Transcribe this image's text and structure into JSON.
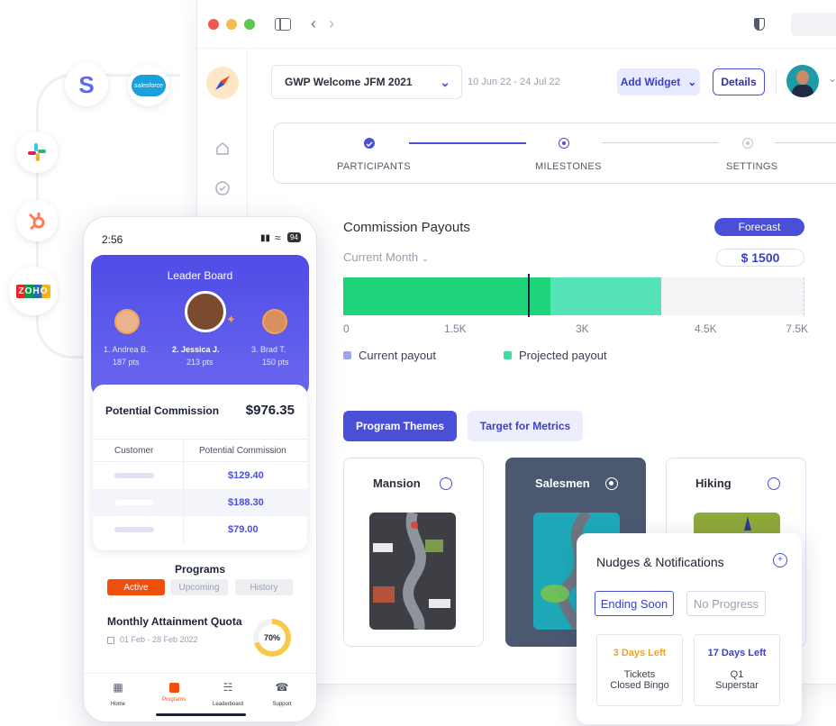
{
  "integrations": [
    "stripe-logo",
    "salesforce-logo",
    "slack-logo",
    "hubspot-logo",
    "zoho-logo"
  ],
  "integration_labels": {
    "salesforce": "salesforce",
    "zoho": "ZOHO",
    "stripe": "S"
  },
  "colors": {
    "accent": "#4a4fd8",
    "current": "#1ed47a",
    "projected": "#55e4b8",
    "active": "#f04e0d",
    "days_orange": "#f0a31e"
  },
  "header": {
    "program_select": "GWP Welcome JFM 2021",
    "date_range": "10 Jun 22 - 24 Jul 22",
    "add_widget": "Add Widget",
    "details": "Details"
  },
  "stepper": {
    "steps": [
      "PARTICIPANTS",
      "MILESTONES",
      "SETTINGS"
    ]
  },
  "payouts": {
    "title": "Commission Payouts",
    "forecast": "Forecast",
    "period": "Current Month",
    "amount": "$ 1500",
    "ticks": [
      "0",
      "1.5K",
      "3K",
      "4.5K",
      "7.5K"
    ],
    "current_fraction": 0.45,
    "projected_fraction": 0.69,
    "marker_fraction": 0.4,
    "legend": {
      "current": "Current payout",
      "projected": "Projected payout"
    }
  },
  "themes_tabs": {
    "program_themes": "Program Themes",
    "target_metrics": "Target for Metrics"
  },
  "themes": [
    {
      "name": "Mansion",
      "selected": false
    },
    {
      "name": "Salesmen",
      "selected": true
    },
    {
      "name": "Hiking",
      "selected": false
    }
  ],
  "phone": {
    "time": "2:56",
    "battery": "94",
    "leaderboard_title": "Leader Board",
    "leaders": [
      {
        "rank_name": "1. Andrea B.",
        "pts": "187 pts"
      },
      {
        "rank_name": "2. Jessica J.",
        "pts": "213 pts"
      },
      {
        "rank_name": "3. Brad T.",
        "pts": "150 pts"
      }
    ],
    "potential_label": "Potential Commission",
    "potential_value": "$976.35",
    "table_headers": [
      "Customer",
      "Potential Commission"
    ],
    "rows": [
      "$129.40",
      "$188.30",
      "$79.00"
    ],
    "programs_title": "Programs",
    "program_tabs": [
      "Active",
      "Upcoming",
      "History"
    ],
    "quota_title": "Monthly Attainment Quota",
    "quota_dates": "01 Feb - 28 Feb 2022",
    "quota_pct": "70%",
    "quota_fraction": 0.7,
    "nav": [
      "Home",
      "Programs",
      "Leaderboard",
      "Support"
    ]
  },
  "nudges": {
    "title": "Nudges & Notifications",
    "filters": [
      "Ending Soon",
      "No Progress"
    ],
    "cards": [
      {
        "days": "3 Days Left",
        "line1": "Tickets",
        "line2": "Closed Bingo"
      },
      {
        "days": "17 Days Left",
        "line1": "Q1",
        "line2": "Superstar"
      }
    ]
  }
}
